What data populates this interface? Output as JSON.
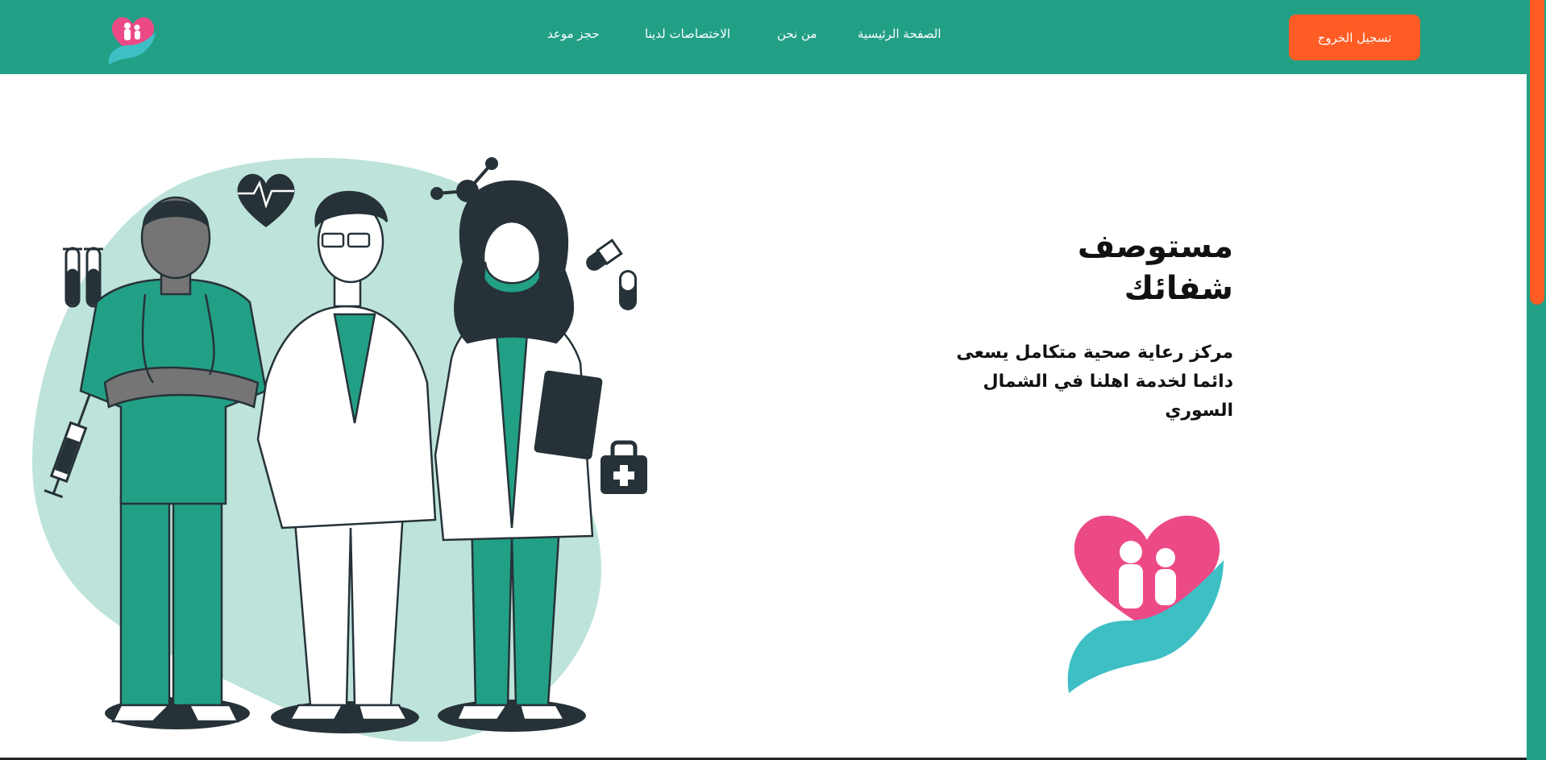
{
  "navbar": {
    "links": {
      "home": "الصفحة الرئيسية",
      "about": "من نحن",
      "specialties": "الاختصاصات لدينا",
      "booking": "حجز موعد"
    },
    "logout_label": "تسجيل الخروج"
  },
  "hero": {
    "title_line1": "مستوصف",
    "title_line2": "شفائك",
    "description": "مركز رعاية صحية متكامل يسعى دائما لخدمة اهلنا في الشمال السوري"
  },
  "colors": {
    "primary": "#22a086",
    "accent": "#ff5b25",
    "logo_pink": "#ec4a86",
    "logo_teal": "#3dbfc4",
    "blob": "#bde3da"
  },
  "icons": [
    "app-logo-icon",
    "heart-pulse-icon",
    "molecule-icon",
    "test-tubes-icon",
    "pill-icon",
    "syringe-icon",
    "first-aid-kit-icon"
  ]
}
